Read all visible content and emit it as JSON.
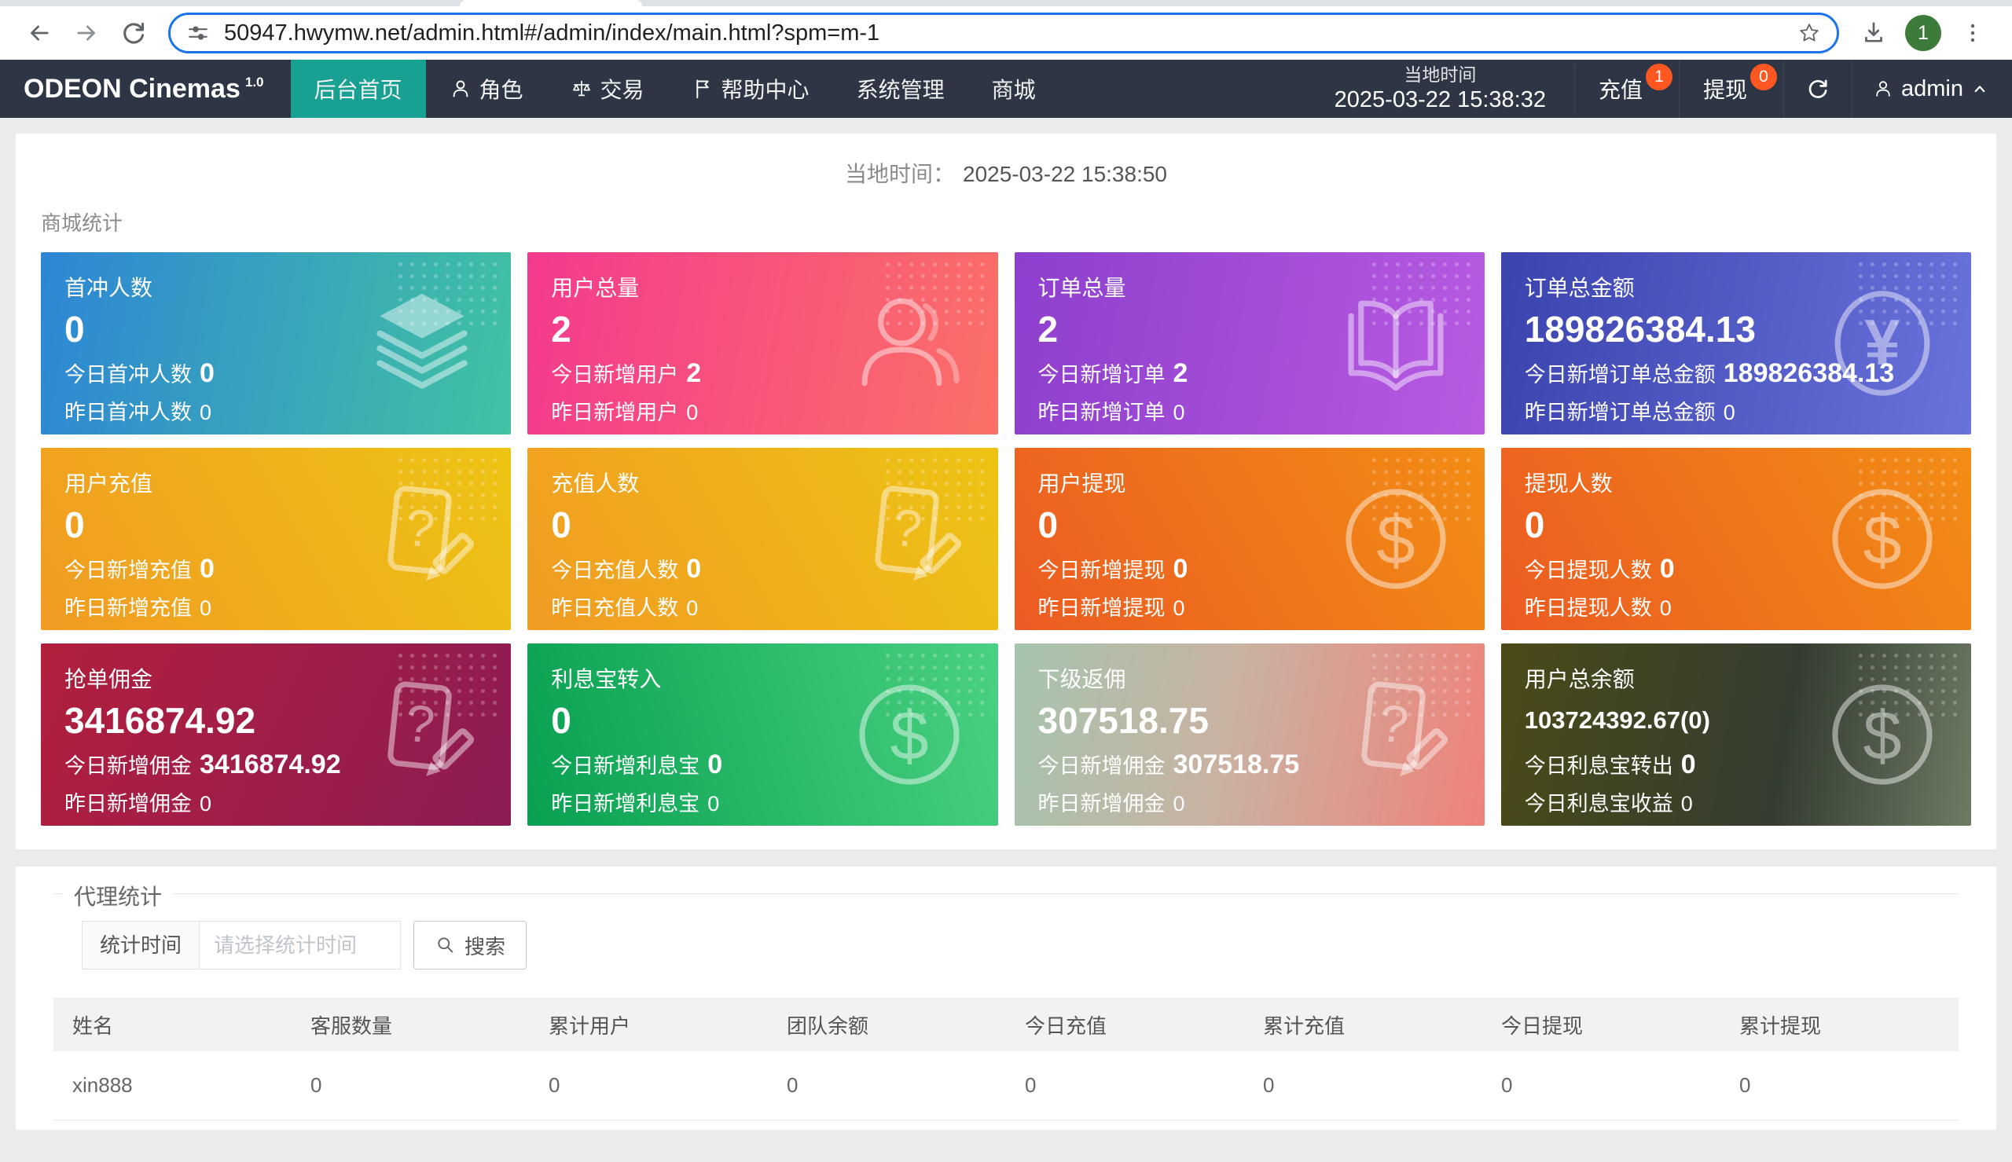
{
  "colors": {
    "badge": "#ff5722",
    "nav_active": "#18a092",
    "navbar_bg": "#2e3544",
    "addr_focus": "#1a73e8",
    "avatar_bg": "#3c7b39"
  },
  "browser": {
    "url": "50947.hwymw.net/admin.html#/admin/index/main.html?spm=m-1",
    "profile_badge": "1"
  },
  "navbar": {
    "brand": "ODEON Cinemas",
    "brand_version": "1.0",
    "menu": [
      {
        "label": "后台首页",
        "icon": null,
        "active": true
      },
      {
        "label": "角色",
        "icon": "person",
        "active": false
      },
      {
        "label": "交易",
        "icon": "scales",
        "active": false
      },
      {
        "label": "帮助中心",
        "icon": "flag",
        "active": false
      },
      {
        "label": "系统管理",
        "icon": null,
        "active": false
      },
      {
        "label": "商城",
        "icon": null,
        "active": false
      }
    ],
    "local_time_label": "当地时间",
    "local_time_value": "2025-03-22 15:38:32",
    "recharge_label": "充值",
    "recharge_badge": "1",
    "withdraw_label": "提现",
    "withdraw_badge": "0",
    "username": "admin"
  },
  "overview": {
    "time_label": "当地时间：",
    "time_value": "2025-03-22 15:38:50",
    "section_title": "商城统计",
    "cards": [
      {
        "title": "首冲人数",
        "value": "0",
        "today_label": "今日首冲人数",
        "today_value": "0",
        "yesterday_label": "昨日首冲人数",
        "yesterday_value": "0",
        "icon": "layers",
        "gradient": {
          "angle": 100,
          "stops": [
            "#2e86d5",
            "#41c2a2"
          ]
        }
      },
      {
        "title": "用户总量",
        "value": "2",
        "today_label": "今日新增用户",
        "today_value": "2",
        "yesterday_label": "昨日新增用户",
        "yesterday_value": "0",
        "icon": "users",
        "gradient": {
          "angle": 100,
          "stops": [
            "#f43a8e",
            "#fb7066"
          ]
        }
      },
      {
        "title": "订单总量",
        "value": "2",
        "today_label": "今日新增订单",
        "today_value": "2",
        "yesterday_label": "昨日新增订单",
        "yesterday_value": "0",
        "icon": "book",
        "gradient": {
          "angle": 100,
          "stops": [
            "#8d3fcd",
            "#b85ae2"
          ]
        }
      },
      {
        "title": "订单总金额",
        "value": "189826384.13",
        "today_label": "今日新增订单总金额",
        "today_value": "189826384.13",
        "yesterday_label": "昨日新增订单总金额",
        "yesterday_value": "0",
        "icon": "yen",
        "gradient": {
          "angle": 100,
          "stops": [
            "#3b43ae",
            "#6a73dc"
          ]
        }
      },
      {
        "title": "用户充值",
        "value": "0",
        "today_label": "今日新增充值",
        "today_value": "0",
        "yesterday_label": "昨日新增充值",
        "yesterday_value": "0",
        "icon": "doc",
        "gradient": {
          "angle": 60,
          "stops": [
            "#f09b22",
            "#eec414"
          ]
        }
      },
      {
        "title": "充值人数",
        "value": "0",
        "today_label": "今日充值人数",
        "today_value": "0",
        "yesterday_label": "昨日充值人数",
        "yesterday_value": "0",
        "icon": "doc",
        "gradient": {
          "angle": 60,
          "stops": [
            "#f09b22",
            "#eec414"
          ]
        }
      },
      {
        "title": "用户提现",
        "value": "0",
        "today_label": "今日新增提现",
        "today_value": "0",
        "yesterday_label": "昨日新增提现",
        "yesterday_value": "0",
        "icon": "dollar",
        "gradient": {
          "angle": 60,
          "stops": [
            "#ec5b22",
            "#f28d14"
          ]
        }
      },
      {
        "title": "提现人数",
        "value": "0",
        "today_label": "今日提现人数",
        "today_value": "0",
        "yesterday_label": "昨日提现人数",
        "yesterday_value": "0",
        "icon": "dollar",
        "gradient": {
          "angle": 60,
          "stops": [
            "#ec5b22",
            "#f28d14"
          ]
        }
      },
      {
        "title": "抢单佣金",
        "value": "3416874.92",
        "today_label": "今日新增佣金",
        "today_value": "3416874.92",
        "yesterday_label": "昨日新增佣金",
        "yesterday_value": "0",
        "icon": "doc",
        "gradient": {
          "angle": 115,
          "stops": [
            "#b21f3c",
            "#8c1c55"
          ]
        }
      },
      {
        "title": "利息宝转入",
        "value": "0",
        "today_label": "今日新增利息宝",
        "today_value": "0",
        "yesterday_label": "昨日新增利息宝",
        "yesterday_value": "0",
        "icon": "dollar",
        "gradient": {
          "angle": 75,
          "stops": [
            "#09a051",
            "#4ad181"
          ]
        }
      },
      {
        "title": "下级返佣",
        "value": "307518.75",
        "today_label": "今日新增佣金",
        "today_value": "307518.75",
        "yesterday_label": "昨日新增佣金",
        "yesterday_value": "0",
        "icon": "doc",
        "gradient": {
          "angle": 100,
          "stops": [
            "#a5c4ae",
            "#c9b2a2 45%",
            "#ef8279"
          ]
        }
      },
      {
        "title": "用户总余额",
        "value": "103724392.67(0)",
        "compact": true,
        "today_label": "今日利息宝转出",
        "today_value": "0",
        "yesterday_label": "今日利息宝收益",
        "yesterday_value": "0",
        "icon": "dollar",
        "gradient": {
          "angle": 100,
          "stops": [
            "#4b4a17",
            "#343d31 60%",
            "#6d7b64"
          ]
        }
      }
    ]
  },
  "agent": {
    "section_title": "代理统计",
    "filter_label": "统计时间",
    "filter_placeholder": "请选择统计时间",
    "search_label": "搜索",
    "table": {
      "headers": [
        "姓名",
        "客服数量",
        "累计用户",
        "团队余额",
        "今日充值",
        "累计充值",
        "今日提现",
        "累计提现"
      ],
      "rows": [
        [
          "xin888",
          "0",
          "0",
          "0",
          "0",
          "0",
          "0",
          "0"
        ]
      ]
    }
  }
}
